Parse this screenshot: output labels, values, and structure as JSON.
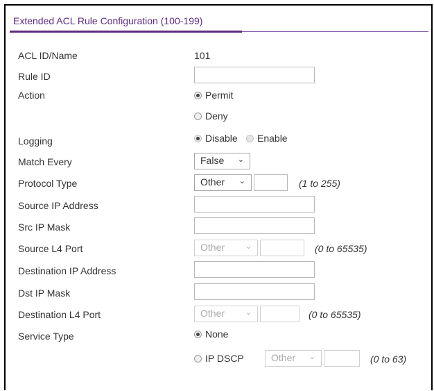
{
  "panel": {
    "title": "Extended ACL Rule Configuration (100-199)"
  },
  "fields": {
    "acl_id_label": "ACL ID/Name",
    "acl_id_value": "101",
    "rule_id_label": "Rule ID",
    "rule_id_value": "",
    "action_label": "Action",
    "action_permit": "Permit",
    "action_deny": "Deny",
    "logging_label": "Logging",
    "logging_disable": "Disable",
    "logging_enable": "Enable",
    "match_every_label": "Match Every",
    "match_every_value": "False",
    "protocol_type_label": "Protocol Type",
    "protocol_type_value": "Other",
    "protocol_type_hint": "(1 to 255)",
    "source_ip_label": "Source IP Address",
    "src_ip_mask_label": "Src IP Mask",
    "source_l4_port_label": "Source L4 Port",
    "source_l4_port_value": "Other",
    "source_l4_port_hint": "(0 to 65535)",
    "dest_ip_label": "Destination IP Address",
    "dst_ip_mask_label": "Dst IP Mask",
    "dest_l4_port_label": "Destination L4 Port",
    "dest_l4_port_value": "Other",
    "dest_l4_port_hint": "(0 to 65535)",
    "service_type_label": "Service Type",
    "service_none": "None",
    "service_ip_dscp": "IP DSCP",
    "ip_dscp_value": "Other",
    "ip_dscp_hint": "(0 to 63)"
  },
  "state": {
    "action_selected": "Permit",
    "logging_selected": "Disable",
    "service_selected": "None"
  },
  "icons": {
    "dropdown": "chevron-down-icon",
    "radio": "radio-icon"
  }
}
